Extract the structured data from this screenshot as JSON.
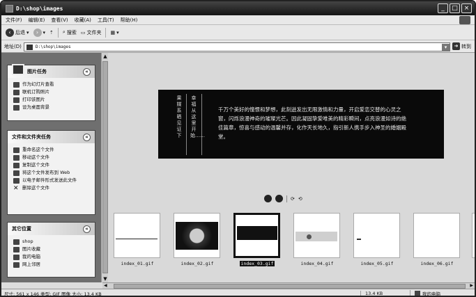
{
  "window": {
    "title": "D:\\shop\\images"
  },
  "menu": [
    "文件(F)",
    "编辑(E)",
    "查看(V)",
    "收藏(A)",
    "工具(T)",
    "帮助(H)"
  ],
  "toolbar": {
    "back": "后退",
    "search": "搜索",
    "folders": "文件夹"
  },
  "address": {
    "label": "地址(D)",
    "value": "D:\\shop\\images",
    "go": "转到"
  },
  "picture_tasks": {
    "title": "图片任务",
    "items": [
      "作为幻灯片查看",
      "联机订购照片",
      "打印该图片",
      "设为桌面背景"
    ]
  },
  "file_tasks": {
    "title": "文件和文件夹任务",
    "items": [
      "重命名这个文件",
      "移动这个文件",
      "复制这个文件",
      "将这个文件发布到 Web",
      "以电子邮件形式发送此文件",
      "删除这个文件"
    ]
  },
  "other_places": {
    "title": "其它位置",
    "items": [
      "shop",
      "图片收藏",
      "我的电脑",
      "网上邻居"
    ]
  },
  "preview": {
    "vertical_1": "果媒系晒见证下",
    "vertical_2": "幸福从这里开始……",
    "paragraph": "千万个美好的憧憬和梦想，此刻迸发出无限激情和力量，开启爱恋交替的心灵之窗，闪烁浪漫神奇的璀璨光芒。因此凝固挚爱唯美的精彩瞬间，点亮浪漫如诗的绝佳篇章，惊喜与感动的温馨并存，化作天长地久，指引新人携手步入神圣的婚姻殿堂。"
  },
  "thumbnails": [
    {
      "name": "index_01.gif",
      "selected": false
    },
    {
      "name": "index_02.gif",
      "selected": false
    },
    {
      "name": "index_03.gif",
      "selected": true
    },
    {
      "name": "index_04.gif",
      "selected": false
    },
    {
      "name": "index_05.gif",
      "selected": false
    },
    {
      "name": "index_06.gif",
      "selected": false
    }
  ],
  "status": {
    "info": "尺寸: 561 x 146 类型: GIF 图像 大小: 13.4 KB",
    "size": "13.4 KB",
    "location": "我的电脑"
  }
}
